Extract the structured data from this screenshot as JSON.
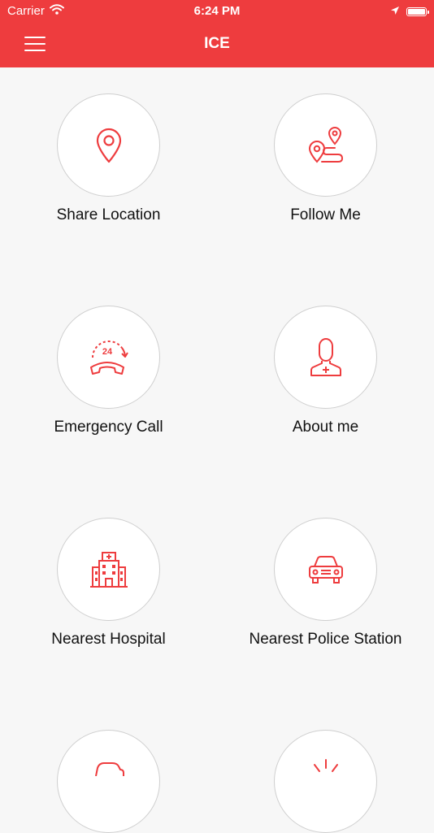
{
  "status_bar": {
    "carrier": "Carrier",
    "time": "6:24 PM"
  },
  "nav": {
    "title": "ICE"
  },
  "colors": {
    "accent": "#ee3c3e",
    "background": "#f7f7f7"
  },
  "tiles": [
    {
      "label": "Share Location",
      "icon": "location-pin-icon"
    },
    {
      "label": "Follow Me",
      "icon": "route-icon"
    },
    {
      "label": "Emergency Call",
      "icon": "phone-24-icon"
    },
    {
      "label": "About me",
      "icon": "user-plus-icon"
    },
    {
      "label": "Nearest Hospital",
      "icon": "hospital-icon"
    },
    {
      "label": "Nearest Police Station",
      "icon": "police-car-icon"
    },
    {
      "label": "",
      "icon": "car-icon"
    },
    {
      "label": "",
      "icon": "alarm-icon"
    }
  ]
}
